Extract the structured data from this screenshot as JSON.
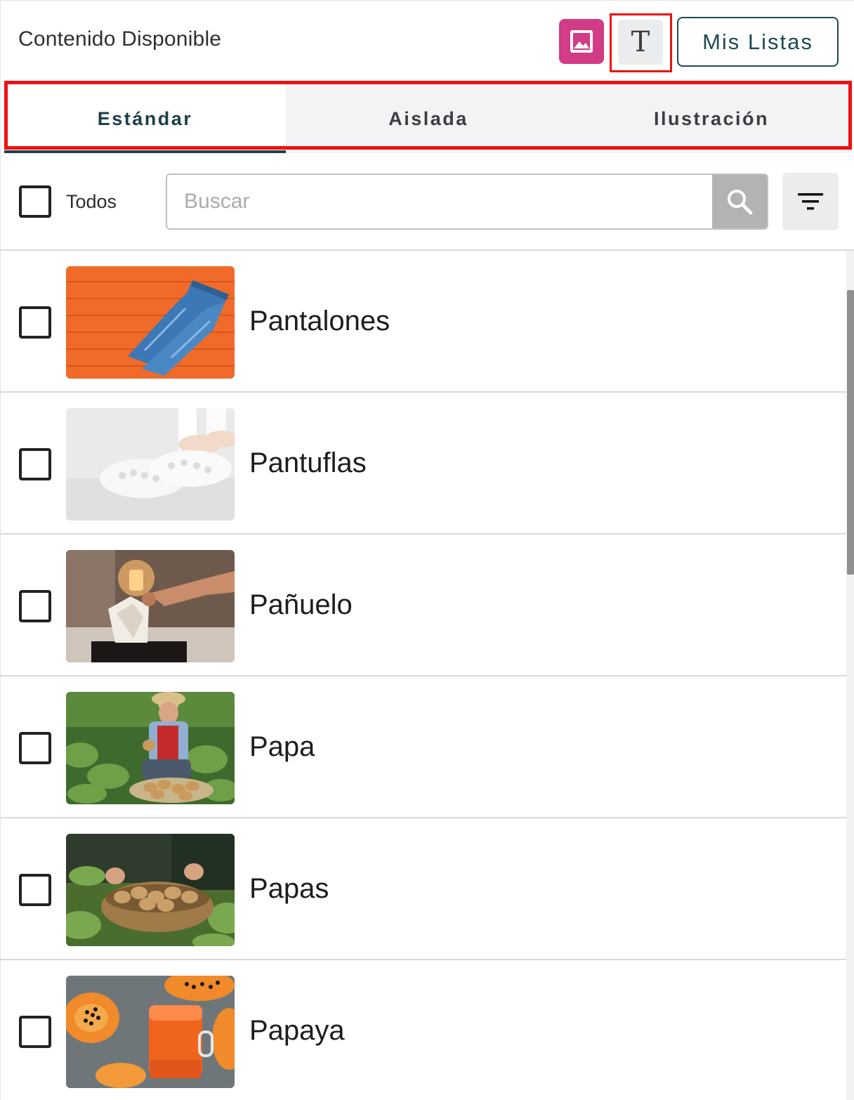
{
  "header": {
    "title": "Contenido Disponible",
    "image_toggle_icon": "image-icon",
    "text_toggle_glyph": "T",
    "my_lists_label": "Mis Listas"
  },
  "tabs": [
    {
      "label": "Estándar",
      "active": true
    },
    {
      "label": "Aislada",
      "active": false
    },
    {
      "label": "Ilustración",
      "active": false
    }
  ],
  "toolbar": {
    "select_all_label": "Todos",
    "select_all_checked": false,
    "search_placeholder": "Buscar",
    "search_value": "",
    "search_icon": "search-icon",
    "filter_icon": "filter-icon"
  },
  "items": [
    {
      "label": "Pantalones",
      "checked": false,
      "thumbnail": "jeans-on-orange-wood"
    },
    {
      "label": "Pantuflas",
      "checked": false,
      "thumbnail": "white-knit-slippers"
    },
    {
      "label": "Pañuelo",
      "checked": false,
      "thumbnail": "hand-pulling-tissue"
    },
    {
      "label": "Papa",
      "checked": false,
      "thumbnail": "farmer-holding-potatoes"
    },
    {
      "label": "Papas",
      "checked": false,
      "thumbnail": "basket-of-potatoes"
    },
    {
      "label": "Papaya",
      "checked": false,
      "thumbnail": "papaya-halves-and-juice"
    }
  ],
  "colors": {
    "accent_pink": "#d23b85",
    "brand_teal": "#1c3f47",
    "highlight_red": "#ee1111"
  }
}
